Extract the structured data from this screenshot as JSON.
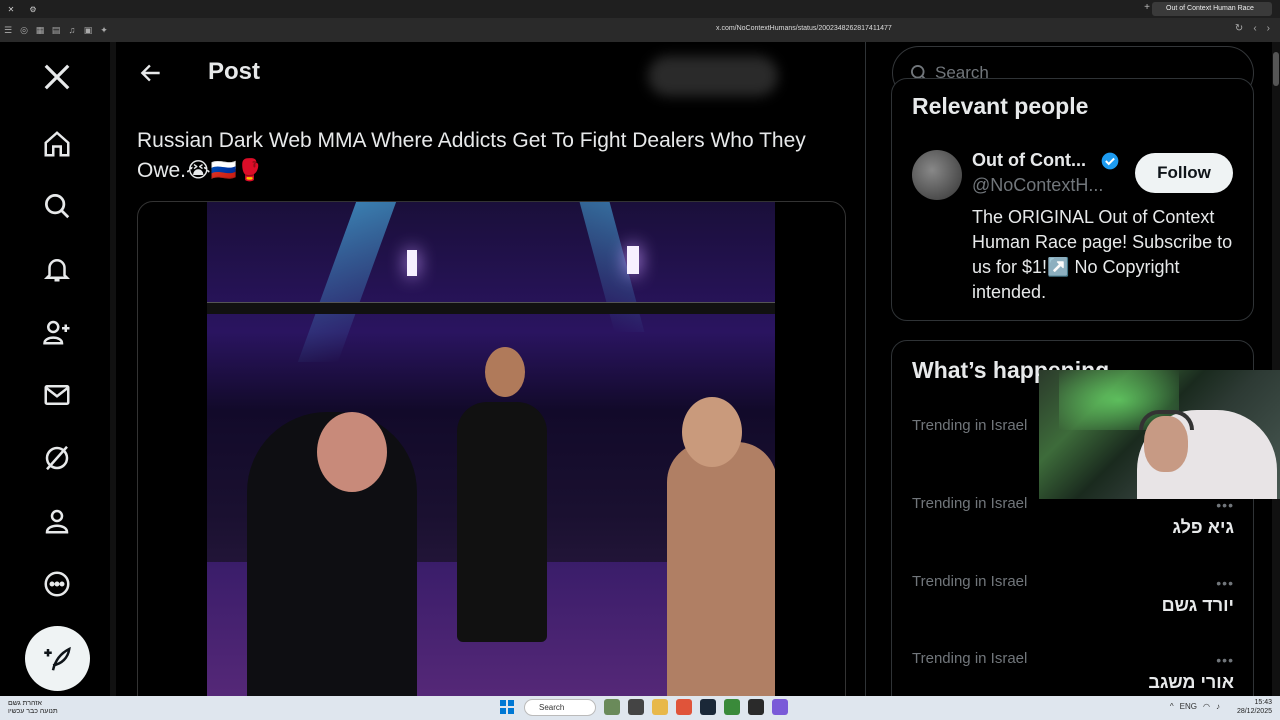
{
  "browser": {
    "tab_title": "Out of Context Human Race",
    "url": "x.com/NoContextHumans/status/2002348262817411477"
  },
  "header": {
    "title": "Post"
  },
  "tweet": {
    "text": "Russian Dark Web MMA Where Addicts Get To Fight Dealers Who They Owe.😭🇷🇺🥊"
  },
  "search": {
    "placeholder": "Search"
  },
  "relevant_people": {
    "title": "Relevant people",
    "name": "Out of Cont...",
    "handle": "@NoContextH...",
    "follow_label": "Follow",
    "bio": "The ORIGINAL Out of Context Human Race page! Subscribe to us for $1!↗️ No Copyright intended."
  },
  "whats_happening": {
    "title": "What’s happening",
    "trends": [
      {
        "meta": "Trending in Israel",
        "name": ""
      },
      {
        "meta": "Trending in Israel",
        "name": "גיא פלג"
      },
      {
        "meta": "Trending in Israel",
        "name": "יורד גשם"
      },
      {
        "meta": "Trending in Israel",
        "name": "אורי משגב"
      }
    ],
    "more_label": "•••"
  },
  "taskbar": {
    "search_label": "Search",
    "weather_line1": "אזהרת גשם",
    "weather_line2": "תנועה כבר עכשיו",
    "time": "15:43",
    "date": "28/12/2025",
    "lang": "ENG"
  },
  "colors": {
    "background": "#000000",
    "text": "#e7e9ea",
    "muted": "#71767b",
    "border": "#2f3336",
    "verified": "#1d9bf0"
  }
}
